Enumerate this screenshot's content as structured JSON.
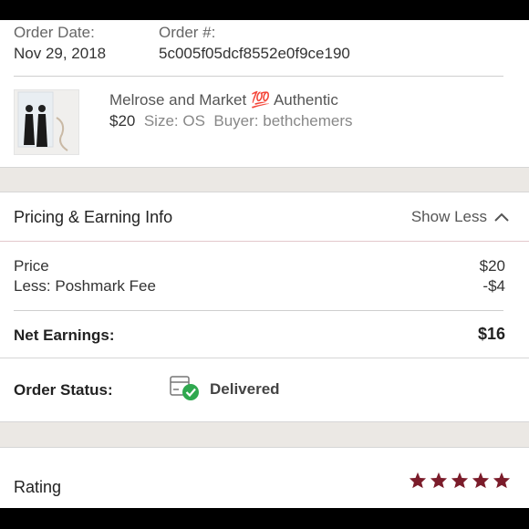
{
  "order": {
    "date_label": "Order Date:",
    "date_value": "Nov 29, 2018",
    "number_label": "Order #:",
    "number_value": "5c005f05dcf8552e0f9ce190"
  },
  "item": {
    "title_prefix": "Melrose and Market",
    "emoji": "💯",
    "title_suffix": "Authentic",
    "price": "$20",
    "size_label": "Size:",
    "size_value": "OS",
    "buyer_label": "Buyer:",
    "buyer_value": "bethchemers"
  },
  "pricing": {
    "title": "Pricing & Earning Info",
    "toggle_label": "Show Less",
    "price_label": "Price",
    "price_value": "$20",
    "fee_label": "Less: Poshmark Fee",
    "fee_value": "-$4",
    "net_label": "Net Earnings:",
    "net_value": "$16"
  },
  "status": {
    "label": "Order Status:",
    "value": "Delivered",
    "icon": "package-delivered-icon"
  },
  "rating": {
    "label": "Rating",
    "stars": 5,
    "max": 5,
    "color": "#7b1c2a"
  }
}
